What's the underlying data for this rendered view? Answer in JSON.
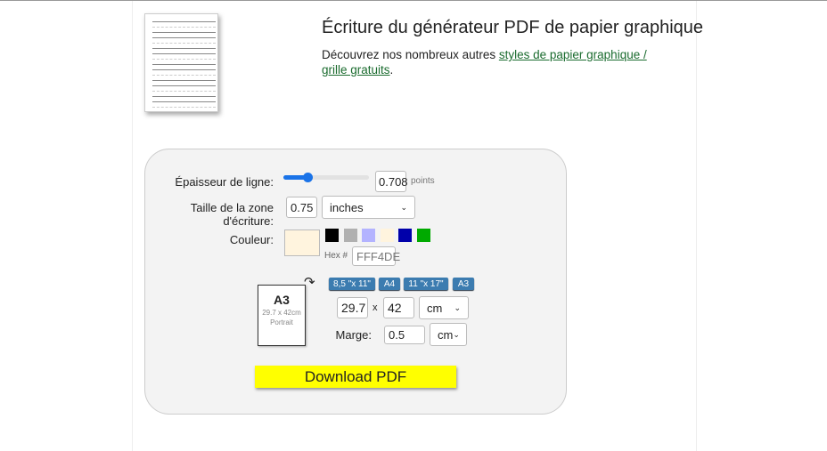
{
  "header": {
    "title": "Écriture du générateur PDF de papier graphique",
    "description_prefix": "Découvrez nos nombreux autres ",
    "link": "styles de papier graphique / grille gratuits",
    "description_suffix": "."
  },
  "form": {
    "line_thickness": {
      "label": "Épaisseur de ligne:",
      "value": "0.708",
      "unit": "points",
      "slider_fraction": 0.28
    },
    "writing_zone": {
      "label": "Taille de la zone d'écriture:",
      "value": "0.75",
      "unit_selected": "inches"
    },
    "color": {
      "label": "Couleur:",
      "current": "#FFF4DE",
      "swatches": [
        "#000000",
        "#B0B0B0",
        "#B3B3FF",
        "#FFF4DE",
        "#0000AA",
        "#00AA00"
      ],
      "hex_label": "Hex #",
      "hex_value": "FFF4DE"
    },
    "paper": {
      "preview_name": "A3",
      "preview_size": "29.7 x 42cm",
      "preview_orientation": "Portrait",
      "presets": [
        "8,5 \"x 11\"",
        "A4",
        "11 \"x 17\"",
        "A3"
      ],
      "width": "29.7",
      "x": "x",
      "height": "42",
      "unit_selected": "cm"
    },
    "margin": {
      "label": "Marge:",
      "value": "0.5",
      "unit_selected": "cm"
    },
    "download_label": "Download PDF"
  }
}
